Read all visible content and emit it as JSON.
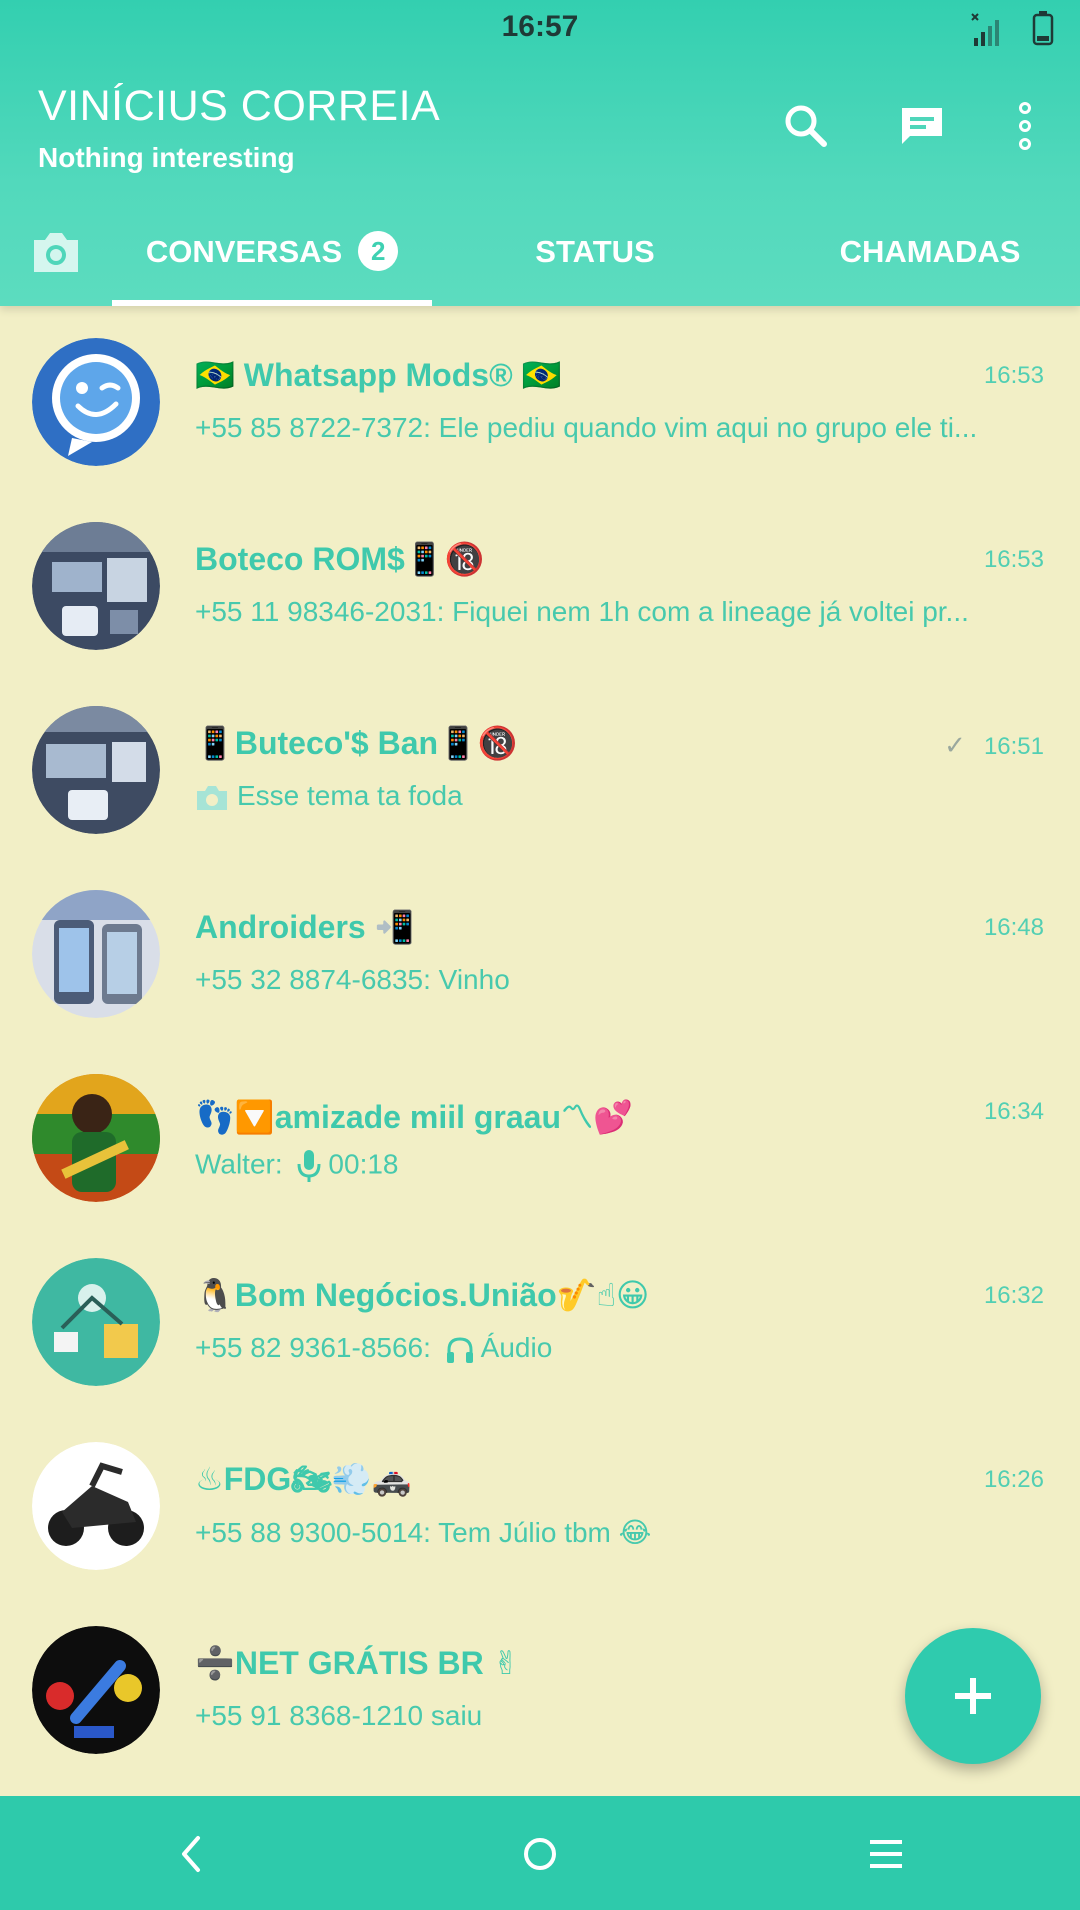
{
  "status_bar": {
    "time": "16:57"
  },
  "header": {
    "account_name": "VINÍCIUS CORREIA",
    "account_status": "Nothing interesting",
    "icons": [
      "search-icon",
      "new-chat-icon",
      "more-options-icon"
    ]
  },
  "tabs": {
    "chats_label": "CONVERSAS",
    "chats_badge": "2",
    "status_label": "STATUS",
    "calls_label": "CHAMADAS"
  },
  "chats": [
    {
      "title": "🇧🇷 Whatsapp Mods® 🇧🇷",
      "preview": "+55 85 8722-7372: Ele pediu quando vim aqui no grupo ele ti...",
      "time": "16:53"
    },
    {
      "title": "Boteco ROM$📱🔞",
      "preview": "+55 11 98346-2031:  Fiquei nem 1h com a lineage já voltei pr...",
      "time": "16:53"
    },
    {
      "title": "📱Buteco'$ Ban📱🔞",
      "preview": "Esse tema ta foda",
      "time": "16:51",
      "sent_tick": "✓"
    },
    {
      "title": "Androiders 📲",
      "preview": "+55 32 8874-6835:  Vinho",
      "time": "16:48"
    },
    {
      "title": "👣🔽amizade miil graau〽💕",
      "preview_sender": "Walter:",
      "preview": "00:18",
      "time": "16:34"
    },
    {
      "title": "🐧Bom Negócios.União🎷☝😀",
      "preview_sender": "+55 82 9361-8566:",
      "preview": "Áudio",
      "time": "16:32"
    },
    {
      "title": "♨FDG🏍💨🚓",
      "preview": "+55 88 9300-5014:  Tem Júlio tbm 😂",
      "time": "16:26"
    },
    {
      "title": "➗NET GRÁTIS BR ✌",
      "preview": "+55 91 8368-1210 saiu",
      "time": ""
    }
  ],
  "colors": {
    "accent": "#33cfb0",
    "background": "#f2efc6",
    "text_teal": "#3fc9ac",
    "fab": "#2fcbae"
  }
}
